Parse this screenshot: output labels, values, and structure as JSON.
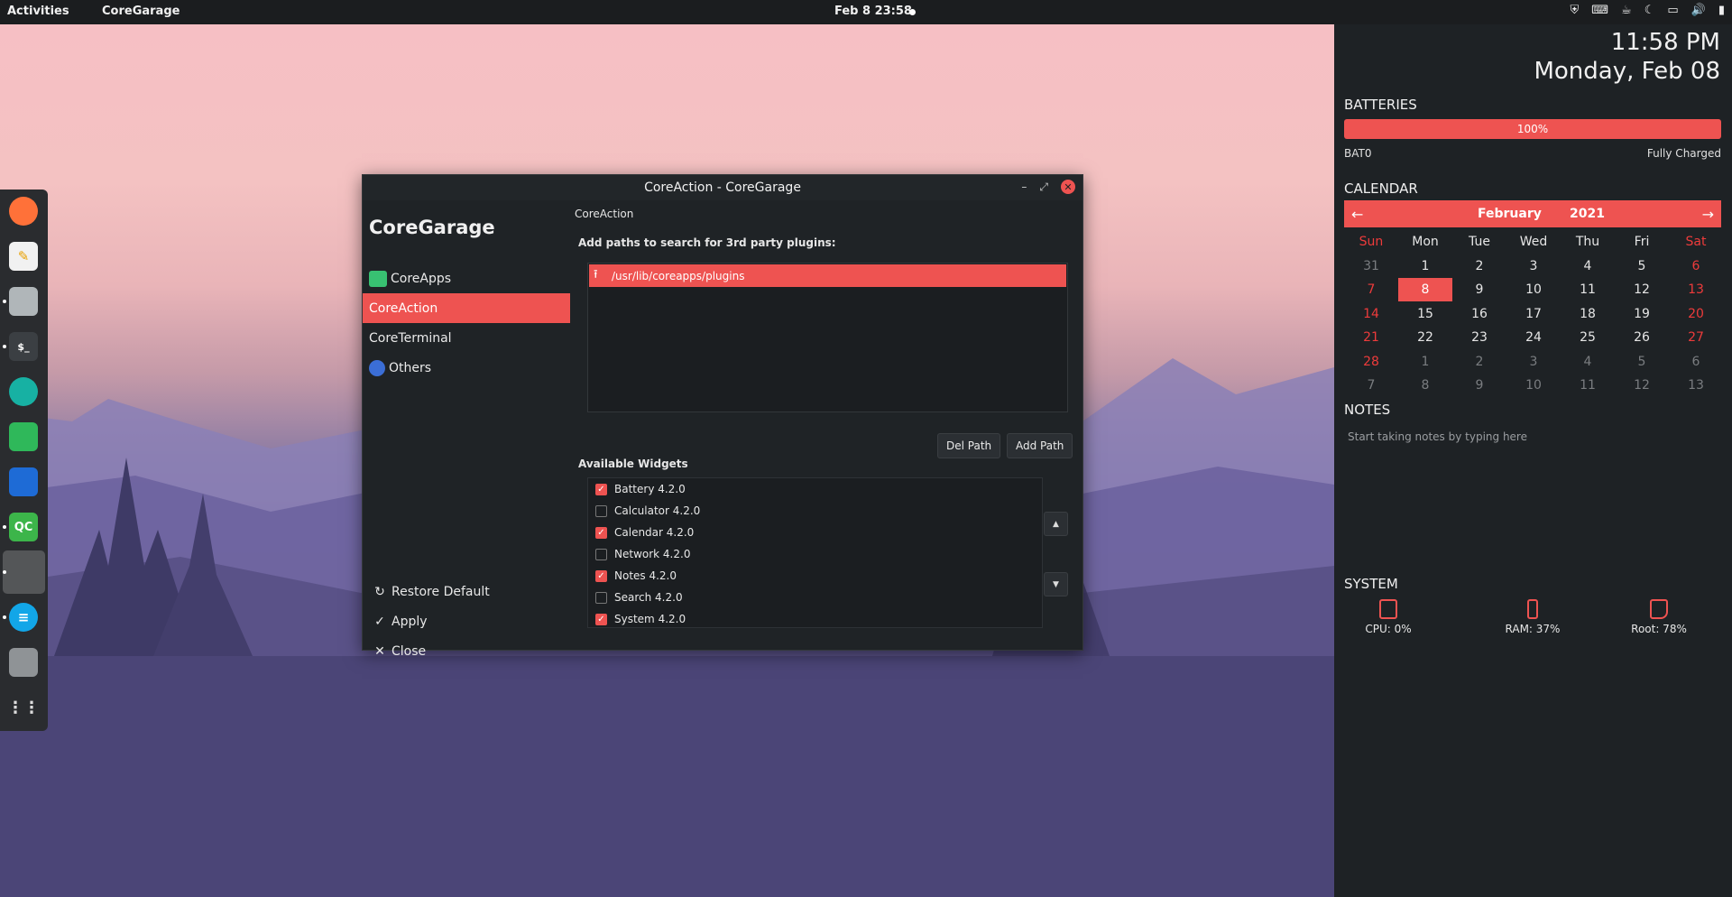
{
  "topbar": {
    "activities": "Activities",
    "app_name": "CoreGarage",
    "clock": "Feb 8  23:58"
  },
  "window": {
    "title": "CoreAction - CoreGarage",
    "sidebar": {
      "title": "CoreGarage",
      "items": [
        {
          "label": "CoreApps"
        },
        {
          "label": "CoreAction"
        },
        {
          "label": "CoreTerminal"
        },
        {
          "label": "Others"
        }
      ],
      "restore": "Restore Default",
      "apply": "Apply",
      "close": "Close"
    },
    "main": {
      "breadcrumb": "CoreAction",
      "paths_label": "Add paths to search for 3rd party plugins:",
      "paths": [
        "/usr/lib/coreapps/plugins"
      ],
      "del_path": "Del Path",
      "add_path": "Add Path",
      "widgets_label": "Available Widgets",
      "widgets": [
        {
          "label": "Battery 4.2.0",
          "checked": true
        },
        {
          "label": "Calculator 4.2.0",
          "checked": false
        },
        {
          "label": "Calendar 4.2.0",
          "checked": true
        },
        {
          "label": "Network 4.2.0",
          "checked": false
        },
        {
          "label": "Notes 4.2.0",
          "checked": true
        },
        {
          "label": "Search 4.2.0",
          "checked": false
        },
        {
          "label": "System 4.2.0",
          "checked": true
        }
      ]
    }
  },
  "panel": {
    "time": "11:58 PM",
    "date": "Monday, Feb 08",
    "batteries": {
      "heading": "BATTERIES",
      "percent": "100%",
      "level": 1.0,
      "name": "BAT0",
      "status": "Fully Charged"
    },
    "calendar": {
      "heading": "CALENDAR",
      "month": "February",
      "year": "2021",
      "weekdays": [
        "Sun",
        "Mon",
        "Tue",
        "Wed",
        "Thu",
        "Fri",
        "Sat"
      ],
      "weeks": [
        [
          "31",
          "1",
          "2",
          "3",
          "4",
          "5",
          "6"
        ],
        [
          "7",
          "8",
          "9",
          "10",
          "11",
          "12",
          "13"
        ],
        [
          "14",
          "15",
          "16",
          "17",
          "18",
          "19",
          "20"
        ],
        [
          "21",
          "22",
          "23",
          "24",
          "25",
          "26",
          "27"
        ],
        [
          "28",
          "1",
          "2",
          "3",
          "4",
          "5",
          "6"
        ],
        [
          "7",
          "8",
          "9",
          "10",
          "11",
          "12",
          "13"
        ]
      ],
      "today": "8"
    },
    "notes": {
      "heading": "NOTES",
      "placeholder": "Start taking notes by typing here"
    },
    "system": {
      "heading": "SYSTEM",
      "cpu": "CPU: 0%",
      "ram": "RAM: 37%",
      "root": "Root: 78%"
    }
  },
  "colors": {
    "accent": "#ee5351",
    "background": "#1f2326"
  }
}
